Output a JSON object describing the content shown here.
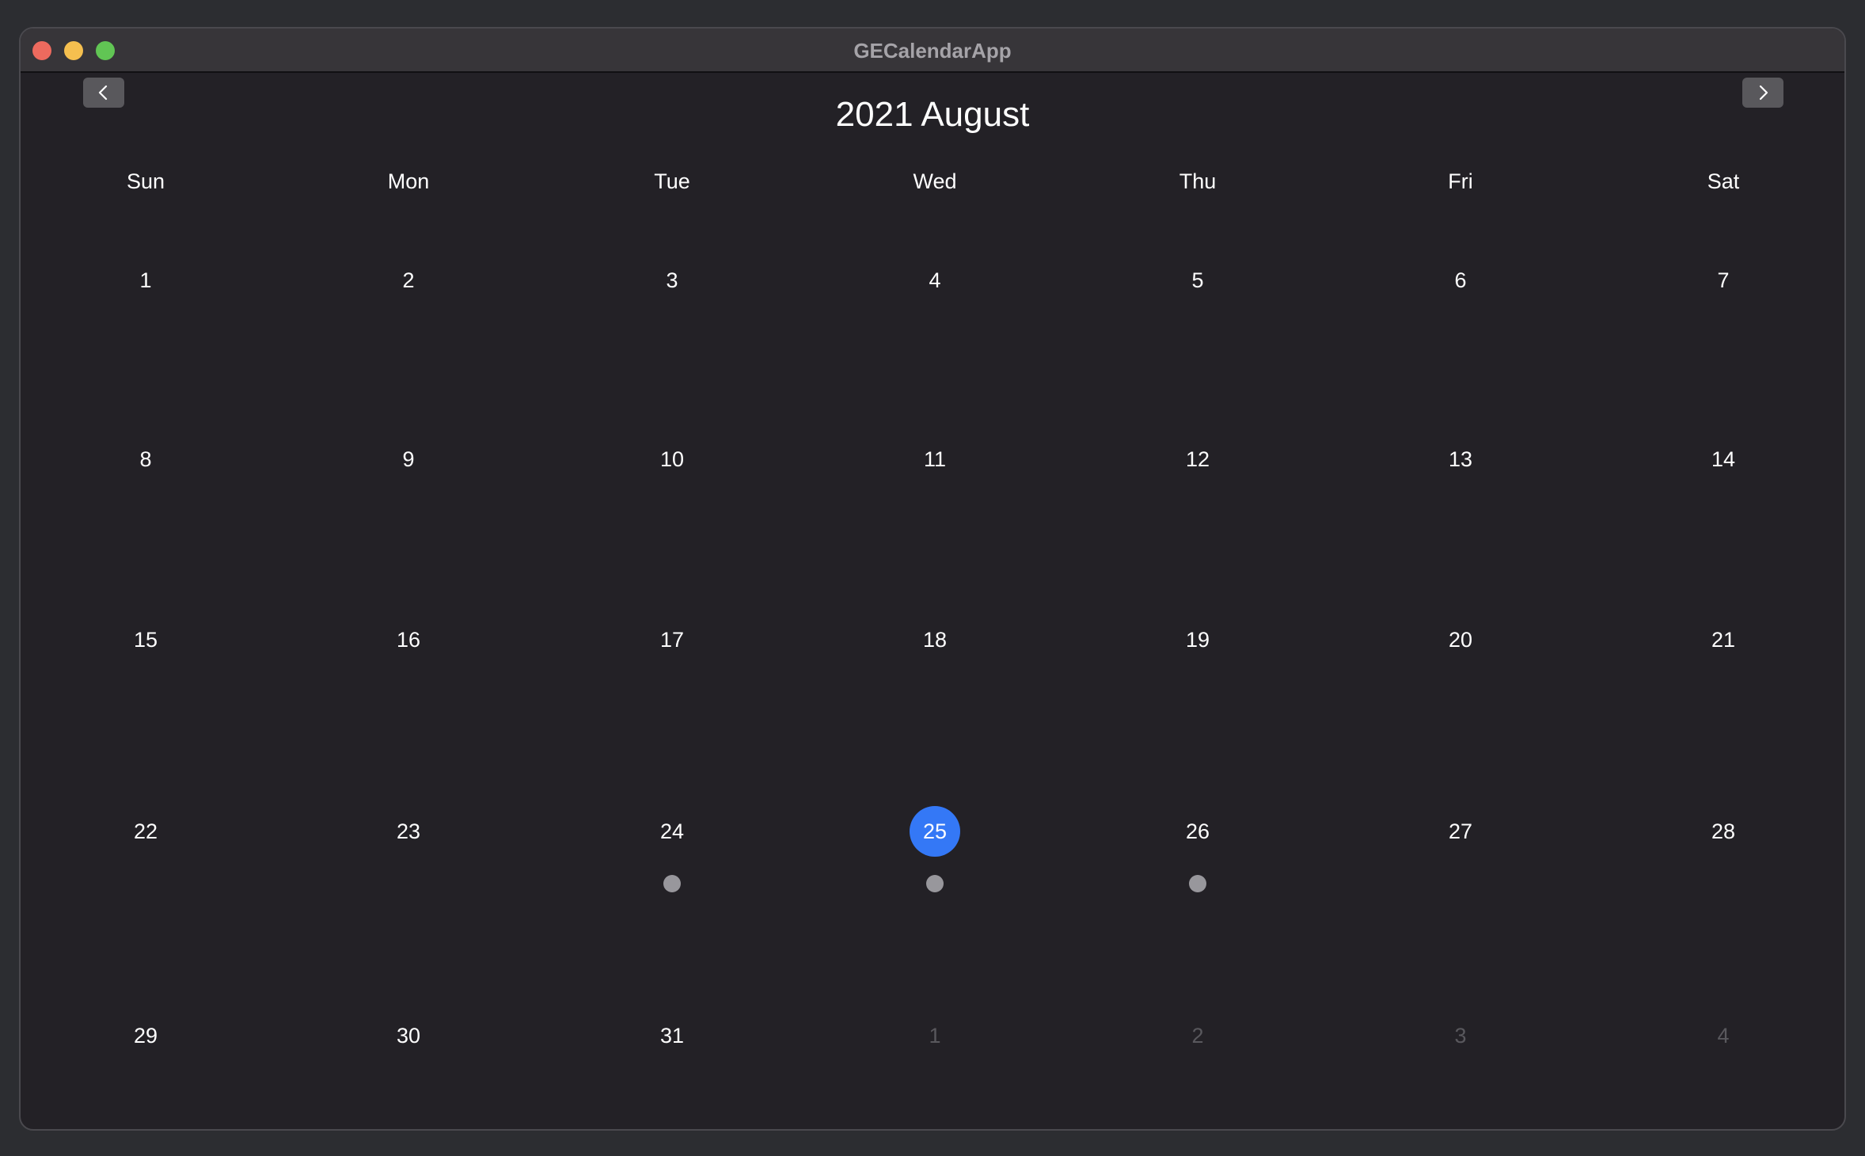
{
  "window": {
    "title": "GECalendarApp"
  },
  "header": {
    "month_title": "2021 August",
    "prev_icon": "chevron-left-icon",
    "next_icon": "chevron-right-icon"
  },
  "weekdays": [
    "Sun",
    "Mon",
    "Tue",
    "Wed",
    "Thu",
    "Fri",
    "Sat"
  ],
  "weeks": [
    [
      {
        "day": "1",
        "in_month": true,
        "selected": false,
        "has_event": false
      },
      {
        "day": "2",
        "in_month": true,
        "selected": false,
        "has_event": false
      },
      {
        "day": "3",
        "in_month": true,
        "selected": false,
        "has_event": false
      },
      {
        "day": "4",
        "in_month": true,
        "selected": false,
        "has_event": false
      },
      {
        "day": "5",
        "in_month": true,
        "selected": false,
        "has_event": false
      },
      {
        "day": "6",
        "in_month": true,
        "selected": false,
        "has_event": false
      },
      {
        "day": "7",
        "in_month": true,
        "selected": false,
        "has_event": false
      }
    ],
    [
      {
        "day": "8",
        "in_month": true,
        "selected": false,
        "has_event": false
      },
      {
        "day": "9",
        "in_month": true,
        "selected": false,
        "has_event": false
      },
      {
        "day": "10",
        "in_month": true,
        "selected": false,
        "has_event": false
      },
      {
        "day": "11",
        "in_month": true,
        "selected": false,
        "has_event": false
      },
      {
        "day": "12",
        "in_month": true,
        "selected": false,
        "has_event": false
      },
      {
        "day": "13",
        "in_month": true,
        "selected": false,
        "has_event": false
      },
      {
        "day": "14",
        "in_month": true,
        "selected": false,
        "has_event": false
      }
    ],
    [
      {
        "day": "15",
        "in_month": true,
        "selected": false,
        "has_event": false
      },
      {
        "day": "16",
        "in_month": true,
        "selected": false,
        "has_event": false
      },
      {
        "day": "17",
        "in_month": true,
        "selected": false,
        "has_event": false
      },
      {
        "day": "18",
        "in_month": true,
        "selected": false,
        "has_event": false
      },
      {
        "day": "19",
        "in_month": true,
        "selected": false,
        "has_event": false
      },
      {
        "day": "20",
        "in_month": true,
        "selected": false,
        "has_event": false
      },
      {
        "day": "21",
        "in_month": true,
        "selected": false,
        "has_event": false
      }
    ],
    [
      {
        "day": "22",
        "in_month": true,
        "selected": false,
        "has_event": false
      },
      {
        "day": "23",
        "in_month": true,
        "selected": false,
        "has_event": false
      },
      {
        "day": "24",
        "in_month": true,
        "selected": false,
        "has_event": true
      },
      {
        "day": "25",
        "in_month": true,
        "selected": true,
        "has_event": true
      },
      {
        "day": "26",
        "in_month": true,
        "selected": false,
        "has_event": true
      },
      {
        "day": "27",
        "in_month": true,
        "selected": false,
        "has_event": false
      },
      {
        "day": "28",
        "in_month": true,
        "selected": false,
        "has_event": false
      }
    ],
    [
      {
        "day": "29",
        "in_month": true,
        "selected": false,
        "has_event": false
      },
      {
        "day": "30",
        "in_month": true,
        "selected": false,
        "has_event": false
      },
      {
        "day": "31",
        "in_month": true,
        "selected": false,
        "has_event": false
      },
      {
        "day": "1",
        "in_month": false,
        "selected": false,
        "has_event": false
      },
      {
        "day": "2",
        "in_month": false,
        "selected": false,
        "has_event": false
      },
      {
        "day": "3",
        "in_month": false,
        "selected": false,
        "has_event": false
      },
      {
        "day": "4",
        "in_month": false,
        "selected": false,
        "has_event": false
      }
    ]
  ],
  "colors": {
    "window_bg": "#232126",
    "titlebar_bg": "#373539",
    "accent_selected": "#3478f6",
    "event_dot": "#98979c",
    "other_month_text": "#59585d",
    "text": "#ffffff"
  }
}
